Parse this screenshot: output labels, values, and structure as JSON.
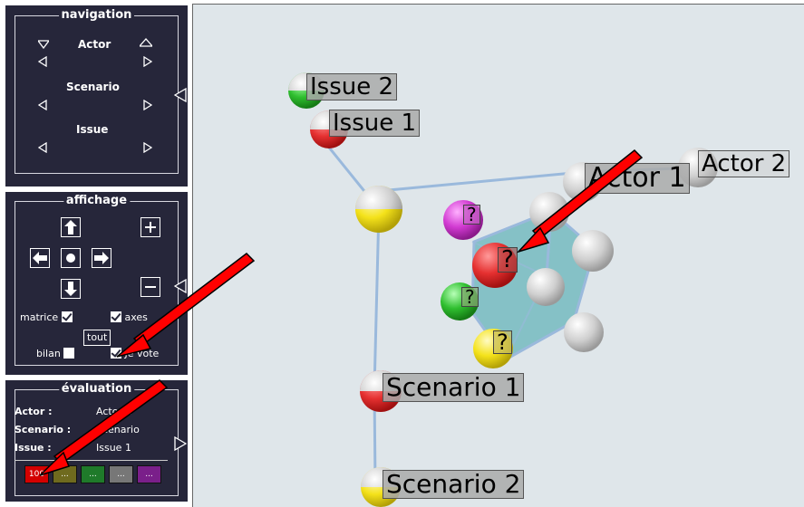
{
  "navigation": {
    "title": "navigation",
    "rows": [
      {
        "label": "Actor"
      },
      {
        "label": "Scenario"
      },
      {
        "label": "Issue"
      }
    ]
  },
  "affichage": {
    "title": "affichage",
    "checkboxes": {
      "matrice": {
        "label": "matrice",
        "checked": true
      },
      "axes": {
        "label": "axes",
        "checked": true
      },
      "bilan": {
        "label": "bilan",
        "checked": false
      },
      "je_vote": {
        "label": "Je vote",
        "checked": true
      }
    },
    "tout_label": "tout"
  },
  "evaluation": {
    "title": "évaluation",
    "rows": [
      {
        "key": "Actor :",
        "value": "Actor 1"
      },
      {
        "key": "Scenario :",
        "value": "Scenario"
      },
      {
        "key": "Issue :",
        "value": "Issue 1"
      }
    ],
    "swatches": [
      {
        "label": "100",
        "color": "#d40000"
      },
      {
        "label": "...",
        "color": "#6f6a1e"
      },
      {
        "label": "...",
        "color": "#1f7a2a"
      },
      {
        "label": "...",
        "color": "#777777"
      },
      {
        "label": "...",
        "color": "#7a1f8a"
      }
    ]
  },
  "scene": {
    "labels": {
      "issue2": "Issue 2",
      "issue1": "Issue 1",
      "actor1": "Actor 1",
      "actor2": "Actor 2",
      "scenario1": "Scenario 1",
      "scenario2": "Scenario 2",
      "q_magenta": "?",
      "q_red": "?",
      "q_green": "?",
      "q_yellow": "?"
    },
    "colors": {
      "background": "#dfe6ea",
      "accent_red": "#e53030",
      "accent_green": "#2fbf2f",
      "accent_yellow": "#f4e21a",
      "accent_magenta": "#d13ad1",
      "cube_fill": "#3aa3a8",
      "arrow": "#ff0000"
    }
  }
}
